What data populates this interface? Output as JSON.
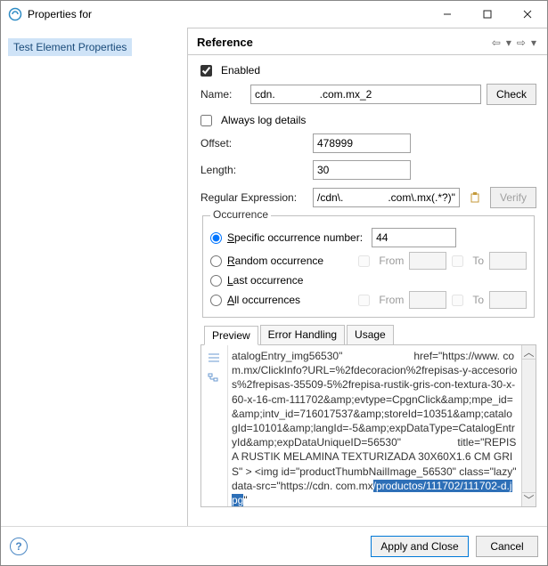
{
  "window": {
    "title": "Properties for"
  },
  "nav": {
    "item0": "Test Element Properties"
  },
  "panel": {
    "heading": "Reference"
  },
  "form": {
    "enabled_label": "Enabled",
    "name_label": "Name:",
    "name_value": "cdn.               .com.mx_2",
    "check_btn": "Check",
    "alwayslog_label": "Always log details",
    "offset_label": "Offset:",
    "offset_value": "478999",
    "length_label": "Length:",
    "length_value": "30",
    "regex_label": "Regular Expression:",
    "regex_value": "/cdn\\.               .com\\.mx(.*?)\"",
    "verify_btn": "Verify"
  },
  "occurrence": {
    "group_label": "Occurrence",
    "specific_label": "Specific occurrence number:",
    "specific_value": "44",
    "random_label": "Random occurrence",
    "last_label": "Last occurrence",
    "all_label": "All occurrences",
    "from_label": "From",
    "to_label": "To"
  },
  "tabs": {
    "preview": "Preview",
    "error": "Error Handling",
    "usage": "Usage"
  },
  "preview": {
    "line1a": "atalogEntry_img56530\"",
    "line1b": "href=\"https://www.",
    "line2": "            com.mx/ClickInfo?URL=%2fdecoracion%2frepisas-y-accesorios%2frepisas-35509-5%2frepisa-rustik-gris-con-textura-30-x-60-x-16-cm-111702&amp;evtype=CpgnClick&amp;mpe_id=&amp;intv_id=716017537&amp;storeId=10351&amp;catalogId=10101&amp;langId=-5&amp;expDataType=CatalogEntryId&amp;expDataUniqueID=56530\"",
    "line3": "title=\"REPISA RUSTIK MELAMINA TEXTURIZADA 30X60X1.6 CM GRIS\" >    <img id=\"productThumbNailImage_56530\" class=\"lazy\" data-src=\"https://cdn.          com.mx",
    "hl": "/productos/111702/111702-d.jpg",
    "tail": "\""
  },
  "footer": {
    "apply": "Apply and Close",
    "cancel": "Cancel"
  }
}
